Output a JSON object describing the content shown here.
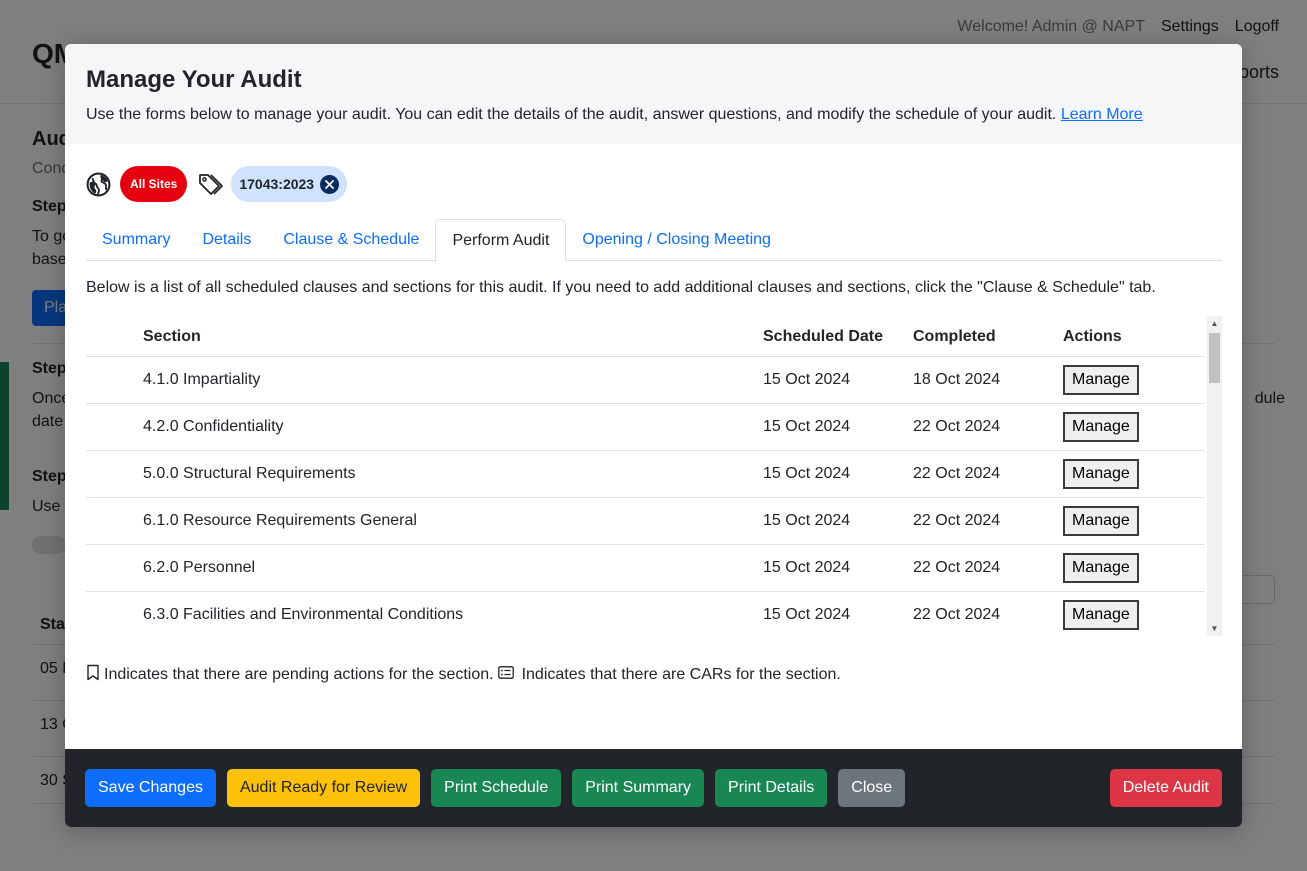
{
  "background": {
    "brand": "QM",
    "welcome": "Welcome! Admin @ NAPT",
    "settings_link": "Settings",
    "logoff_link": "Logoff",
    "nav_partial": "ports",
    "page_title_partial": "Aud",
    "subtitle_partial": "Cond",
    "step1_partial": "Step",
    "step1_text_partial": "To go",
    "step1_text2_partial": "based",
    "button_partial": "Pla",
    "step2_partial": "Step",
    "step2_text_partial": "Once",
    "step2_text2_partial": "date",
    "step2_right_partial": "dule",
    "step3_partial": "Step",
    "step3_text_partial": "Use t",
    "table_header_partial": "Star",
    "row1_partial": "05 M",
    "row2_partial": "13 O",
    "row3_partial": "30 S"
  },
  "modal": {
    "title": "Manage Your Audit",
    "description": "Use the forms below to manage your audit. You can edit the details of the audit, answer questions, and modify the schedule of your audit.",
    "learn_more": "Learn More",
    "sites_pill": "All Sites",
    "standard_pill": "17043:2023",
    "tabs": [
      {
        "label": "Summary"
      },
      {
        "label": "Details"
      },
      {
        "label": "Clause & Schedule"
      },
      {
        "label": "Perform Audit"
      },
      {
        "label": "Opening / Closing Meeting"
      }
    ],
    "intro": "Below is a list of all scheduled clauses and sections for this audit. If you need to add additional clauses and sections, click the \"Clause & Schedule\" tab.",
    "table": {
      "headers": {
        "section": "Section",
        "scheduled": "Scheduled Date",
        "completed": "Completed",
        "actions": "Actions"
      },
      "action_label": "Manage",
      "rows": [
        {
          "section": "4.1.0 Impartiality",
          "scheduled": "15 Oct 2024",
          "completed": "18 Oct 2024"
        },
        {
          "section": "4.2.0 Confidentiality",
          "scheduled": "15 Oct 2024",
          "completed": "22 Oct 2024"
        },
        {
          "section": "5.0.0 Structural Requirements",
          "scheduled": "15 Oct 2024",
          "completed": "22 Oct 2024"
        },
        {
          "section": "6.1.0 Resource Requirements General",
          "scheduled": "15 Oct 2024",
          "completed": "22 Oct 2024"
        },
        {
          "section": "6.2.0 Personnel",
          "scheduled": "15 Oct 2024",
          "completed": "22 Oct 2024"
        },
        {
          "section": "6.3.0 Facilities and Environmental Conditions",
          "scheduled": "15 Oct 2024",
          "completed": "22 Oct 2024"
        }
      ]
    },
    "legend": {
      "pending": "Indicates that there are pending actions for the section.",
      "cars": "Indicates that there are CARs for the section."
    },
    "footer": {
      "save": "Save Changes",
      "review": "Audit Ready for Review",
      "print_schedule": "Print Schedule",
      "print_summary": "Print Summary",
      "print_details": "Print Details",
      "close": "Close",
      "delete": "Delete Audit"
    },
    "colors": {
      "primary": "#0d6efd",
      "warning": "#ffc107",
      "success": "#198754",
      "secondary": "#6c757d",
      "danger": "#dc3545",
      "sites_pill": "#e5000f",
      "standard_pill": "#cfe2ff",
      "footer_bg": "#212529"
    }
  }
}
